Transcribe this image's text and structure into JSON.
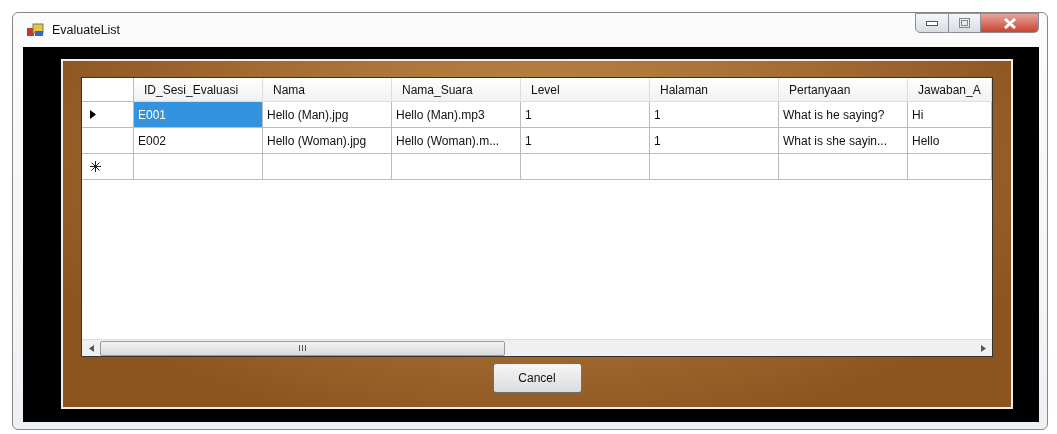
{
  "window": {
    "title": "EvaluateList"
  },
  "table": {
    "columns": [
      "ID_Sesi_Evaluasi",
      "Nama",
      "Nama_Suara",
      "Level",
      "Halaman",
      "Pertanyaan",
      "Jawaban_A"
    ],
    "rows": [
      {
        "kind": "data",
        "current": true,
        "cells": [
          {
            "text": "E001",
            "selected": true
          },
          {
            "text": "Hello (Man).jpg",
            "selected": false
          },
          {
            "text": "Hello (Man).mp3",
            "selected": false
          },
          {
            "text": "1",
            "selected": false
          },
          {
            "text": "1",
            "selected": false
          },
          {
            "text": "What is he saying?",
            "selected": false
          },
          {
            "text": "Hi",
            "selected": false
          }
        ]
      },
      {
        "kind": "data",
        "current": false,
        "cells": [
          {
            "text": "E002",
            "selected": false
          },
          {
            "text": "Hello (Woman).jpg",
            "selected": false
          },
          {
            "text": "Hello (Woman).m...",
            "selected": false
          },
          {
            "text": "1",
            "selected": false
          },
          {
            "text": "1",
            "selected": false
          },
          {
            "text": "What is she sayin...",
            "selected": false
          },
          {
            "text": "Hello",
            "selected": false
          }
        ]
      },
      {
        "kind": "new",
        "current": false
      }
    ]
  },
  "buttons": [
    {
      "label": "Cancel"
    }
  ]
}
